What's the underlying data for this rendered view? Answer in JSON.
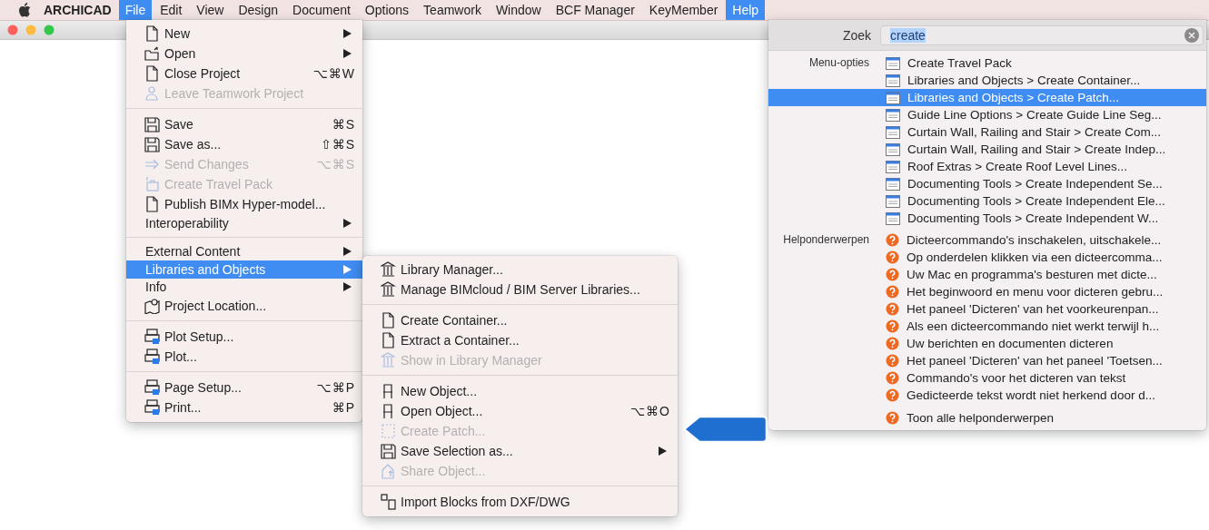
{
  "menu_bar": {
    "app_name": "ARCHICAD",
    "items": [
      {
        "label": "File",
        "selected": true
      },
      {
        "label": "Edit",
        "selected": false
      },
      {
        "label": "View",
        "selected": false
      },
      {
        "label": "Design",
        "selected": false
      },
      {
        "label": "Document",
        "selected": false
      },
      {
        "label": "Options",
        "selected": false
      },
      {
        "label": "Teamwork",
        "selected": false
      },
      {
        "label": "Window",
        "selected": false
      },
      {
        "label": "BCF Manager",
        "selected": false
      },
      {
        "label": "KeyMember",
        "selected": false
      },
      {
        "label": "Help",
        "selected": true
      }
    ]
  },
  "file_menu": {
    "groups": [
      {
        "items": [
          {
            "label": "New",
            "kind": "icon",
            "submenu": true,
            "disabled": false,
            "selected": false
          },
          {
            "label": "Open",
            "kind": "icon",
            "submenu": true,
            "disabled": false,
            "selected": false
          },
          {
            "label": "Close Project",
            "kind": "icon",
            "shortcut": "⌥⌘W",
            "submenu": false,
            "disabled": false,
            "selected": false
          },
          {
            "label": "Leave Teamwork Project",
            "kind": "icon",
            "submenu": false,
            "disabled": true,
            "selected": false
          }
        ]
      },
      {
        "items": [
          {
            "label": "Save",
            "kind": "icon",
            "shortcut": "⌘S",
            "submenu": false,
            "disabled": false,
            "selected": false
          },
          {
            "label": "Save as...",
            "kind": "icon",
            "shortcut": "⇧⌘S",
            "submenu": false,
            "disabled": false,
            "selected": false
          },
          {
            "label": "Send Changes",
            "kind": "icon",
            "shortcut": "⌥⌘S",
            "submenu": false,
            "disabled": true,
            "selected": false
          },
          {
            "label": "Create Travel Pack",
            "kind": "icon",
            "submenu": false,
            "disabled": true,
            "selected": false
          },
          {
            "label": "Publish BIMx Hyper-model...",
            "kind": "icon",
            "submenu": false,
            "disabled": false,
            "selected": false
          },
          {
            "label": "Interoperability",
            "kind": "plain",
            "submenu": true,
            "disabled": false,
            "selected": false
          }
        ]
      },
      {
        "items": [
          {
            "label": "External Content",
            "kind": "plain",
            "submenu": true,
            "disabled": false,
            "selected": false
          },
          {
            "label": "Libraries and Objects",
            "kind": "plain",
            "submenu": true,
            "disabled": false,
            "selected": true
          },
          {
            "label": "Info",
            "kind": "plain",
            "submenu": true,
            "disabled": false,
            "selected": false
          },
          {
            "label": "Project Location...",
            "kind": "icon",
            "submenu": false,
            "disabled": false,
            "selected": false
          }
        ]
      },
      {
        "items": [
          {
            "label": "Plot Setup...",
            "kind": "icon",
            "submenu": false,
            "disabled": false,
            "selected": false
          },
          {
            "label": "Plot...",
            "kind": "icon",
            "submenu": false,
            "disabled": false,
            "selected": false
          }
        ]
      },
      {
        "items": [
          {
            "label": "Page Setup...",
            "kind": "icon",
            "shortcut": "⌥⌘P",
            "submenu": false,
            "disabled": false,
            "selected": false
          },
          {
            "label": "Print...",
            "kind": "icon",
            "shortcut": "⌘P",
            "submenu": false,
            "disabled": false,
            "selected": false
          }
        ]
      }
    ]
  },
  "libraries_submenu": {
    "groups": [
      {
        "items": [
          {
            "label": "Library Manager...",
            "kind": "icon",
            "submenu": false,
            "disabled": false,
            "selected": false
          },
          {
            "label": "Manage BIMcloud / BIM Server Libraries...",
            "kind": "icon",
            "submenu": false,
            "disabled": false,
            "selected": false
          }
        ]
      },
      {
        "items": [
          {
            "label": "Create Container...",
            "kind": "icon",
            "submenu": false,
            "disabled": false,
            "selected": false
          },
          {
            "label": "Extract a Container...",
            "kind": "icon",
            "submenu": false,
            "disabled": false,
            "selected": false
          },
          {
            "label": "Show in Library Manager",
            "kind": "icon",
            "submenu": false,
            "disabled": true,
            "selected": false
          }
        ]
      },
      {
        "items": [
          {
            "label": "New Object...",
            "kind": "icon",
            "submenu": false,
            "disabled": false,
            "selected": false
          },
          {
            "label": "Open Object...",
            "kind": "icon",
            "shortcut": "⌥⌘O",
            "submenu": false,
            "disabled": false,
            "selected": false
          },
          {
            "label": "Create Patch...",
            "kind": "icon",
            "submenu": false,
            "disabled": true,
            "selected": false
          },
          {
            "label": "Save Selection as...",
            "kind": "icon",
            "submenu": true,
            "disabled": false,
            "selected": false
          },
          {
            "label": "Share Object...",
            "kind": "icon",
            "submenu": false,
            "disabled": true,
            "selected": false
          }
        ]
      },
      {
        "items": [
          {
            "label": "Import Blocks from DXF/DWG",
            "kind": "icon",
            "submenu": false,
            "disabled": false,
            "selected": false
          }
        ]
      }
    ]
  },
  "help_panel": {
    "search": {
      "label": "Zoek",
      "value": "create"
    },
    "sections": [
      {
        "label": "Menu-opties",
        "kind": "menu",
        "items": [
          {
            "label": "Create Travel Pack",
            "selected": false
          },
          {
            "label": "Libraries and Objects > Create Container...",
            "selected": false
          },
          {
            "label": "Libraries and Objects > Create Patch...",
            "selected": true
          },
          {
            "label": "Guide Line Options > Create Guide Line Seg...",
            "selected": false
          },
          {
            "label": "Curtain Wall, Railing and Stair > Create Com...",
            "selected": false
          },
          {
            "label": "Curtain Wall, Railing and Stair > Create Indep...",
            "selected": false
          },
          {
            "label": "Roof Extras > Create Roof Level Lines...",
            "selected": false
          },
          {
            "label": "Documenting Tools > Create Independent Se...",
            "selected": false
          },
          {
            "label": "Documenting Tools > Create Independent Ele...",
            "selected": false
          },
          {
            "label": "Documenting Tools > Create Independent W...",
            "selected": false
          }
        ]
      },
      {
        "label": "Helponderwerpen",
        "kind": "help",
        "items": [
          {
            "label": "Dicteercommando's inschakelen, uitschakele...",
            "selected": false
          },
          {
            "label": "Op onderdelen klikken via een dicteercomma...",
            "selected": false
          },
          {
            "label": "Uw Mac en programma's besturen met dicte...",
            "selected": false
          },
          {
            "label": "Het beginwoord en menu voor dicteren gebru...",
            "selected": false
          },
          {
            "label": "Het paneel 'Dicteren' van het voorkeurenpan...",
            "selected": false
          },
          {
            "label": "Als een dicteercommando niet werkt terwijl h...",
            "selected": false
          },
          {
            "label": "Uw berichten en documenten dicteren",
            "selected": false
          },
          {
            "label": "Het paneel 'Dicteren' van het paneel 'Toetsen...",
            "selected": false
          },
          {
            "label": "Commando's voor het dicteren van tekst",
            "selected": false
          },
          {
            "label": "Gedicteerde tekst wordt niet herkend door d...",
            "selected": false
          }
        ]
      }
    ],
    "show_all": {
      "label": "Toon alle helponderwerpen"
    }
  }
}
